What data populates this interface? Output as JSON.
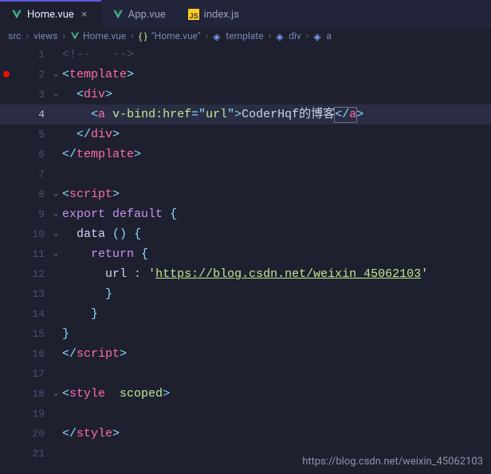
{
  "tabs": [
    {
      "icon": "vue",
      "label": "Home.vue",
      "active": true,
      "close": true
    },
    {
      "icon": "vue",
      "label": "App.vue",
      "active": false,
      "close": false
    },
    {
      "icon": "js",
      "label": "index.js",
      "active": false,
      "close": false
    }
  ],
  "breadcrumbs": [
    {
      "label": "src",
      "icon": ""
    },
    {
      "label": "views",
      "icon": ""
    },
    {
      "label": "Home.vue",
      "icon": "vue"
    },
    {
      "label": "\"Home.vue\"",
      "icon": "braces"
    },
    {
      "label": "template",
      "icon": "block"
    },
    {
      "label": "div",
      "icon": "block"
    },
    {
      "label": "a",
      "icon": "block"
    }
  ],
  "sep": "›",
  "js_badge": "JS",
  "code": {
    "l1": {
      "num": "1",
      "comment_open": "<!--",
      "comment_close": "-->"
    },
    "l2": {
      "num": "2",
      "fold": "⌄",
      "open": "<",
      "tag": "template",
      "close": ">"
    },
    "l3": {
      "num": "3",
      "fold": "⌄",
      "open": "<",
      "tag": "div",
      "close": ">"
    },
    "l4": {
      "num": "4",
      "open": "<",
      "tag": "a",
      "attr": "v-bind:href",
      "eq": "=",
      "q": "\"",
      "val": "url",
      "close": ">",
      "text": "CoderHqf的博客",
      "copen": "<",
      "cslash": "/",
      "ctag": "a",
      "cclose": ">"
    },
    "l5": {
      "num": "5",
      "open": "</",
      "tag": "div",
      "close": ">"
    },
    "l6": {
      "num": "6",
      "open": "</",
      "tag": "template",
      "close": ">"
    },
    "l7": {
      "num": "7"
    },
    "l8": {
      "num": "8",
      "fold": "⌄",
      "open": "<",
      "tag": "script",
      "close": ">"
    },
    "l9": {
      "num": "9",
      "fold": "⌄",
      "kw1": "export",
      "kw2": "default",
      "brace": "{"
    },
    "l10": {
      "num": "10",
      "fold": "⌄",
      "name": "data",
      "paren": "()",
      "brace": "{"
    },
    "l11": {
      "num": "11",
      "fold": "⌄",
      "kw": "return",
      "brace": "{"
    },
    "l12": {
      "num": "12",
      "key": "url",
      "colon": ":",
      "q": "'",
      "val": "https://blog.csdn.net/weixin_45062103"
    },
    "l13": {
      "num": "13",
      "brace": "}"
    },
    "l14": {
      "num": "14",
      "brace": "}"
    },
    "l15": {
      "num": "15",
      "brace": "}"
    },
    "l16": {
      "num": "16",
      "open": "</",
      "tag": "script",
      "close": ">"
    },
    "l17": {
      "num": "17"
    },
    "l18": {
      "num": "18",
      "fold": "⌄",
      "open": "<",
      "tag": "style",
      "attr": "scoped",
      "close": ">"
    },
    "l19": {
      "num": "19"
    },
    "l20": {
      "num": "20",
      "open": "</",
      "tag": "style",
      "close": ">"
    },
    "l21": {
      "num": "21"
    }
  },
  "watermark": "https://blog.csdn.net/weixin_45062103"
}
